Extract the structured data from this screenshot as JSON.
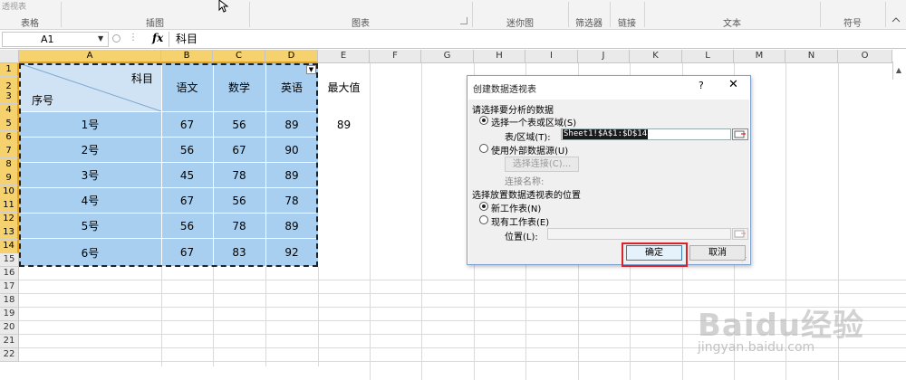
{
  "ribbon": {
    "top_text": "透视表",
    "groups": [
      {
        "name": "table",
        "label": "表格"
      },
      {
        "name": "illustrations",
        "label": "插图"
      },
      {
        "name": "charts",
        "label": "图表"
      },
      {
        "name": "sparklines",
        "label": "迷你图"
      },
      {
        "name": "filters",
        "label": "筛选器"
      },
      {
        "name": "links",
        "label": "链接"
      },
      {
        "name": "text",
        "label": "文本"
      },
      {
        "name": "symbols",
        "label": "符号"
      }
    ]
  },
  "formula_bar": {
    "name_box": "A1",
    "fx_label": "fx",
    "content": "科目"
  },
  "sheet": {
    "columns": [
      "A",
      "B",
      "C",
      "D",
      "E",
      "F",
      "G",
      "H",
      "I",
      "J",
      "K",
      "L",
      "M",
      "N",
      "O"
    ],
    "rows": [
      "1",
      "2",
      "3",
      "4",
      "5",
      "6",
      "7",
      "8",
      "9",
      "10",
      "11",
      "12",
      "13",
      "14",
      "15",
      "16",
      "17",
      "18",
      "19",
      "20",
      "21",
      "22"
    ],
    "header": {
      "diag_top": "科目",
      "diag_bottom": "序号",
      "subjects": [
        "语文",
        "数学",
        "英语"
      ],
      "max_label": "最大值"
    },
    "students": [
      {
        "id": "1号",
        "scores": [
          67,
          56,
          89
        ]
      },
      {
        "id": "2号",
        "scores": [
          56,
          67,
          90
        ]
      },
      {
        "id": "3号",
        "scores": [
          45,
          78,
          89
        ]
      },
      {
        "id": "4号",
        "scores": [
          67,
          56,
          78
        ]
      },
      {
        "id": "5号",
        "scores": [
          56,
          78,
          89
        ]
      },
      {
        "id": "6号",
        "scores": [
          67,
          83,
          92
        ]
      }
    ],
    "max_value": 89
  },
  "dialog": {
    "title": "创建数据透视表",
    "help": "?",
    "close": "✕",
    "section1": "请选择要分析的数据",
    "option_table": "选择一个表或区域(S)",
    "range_label": "表/区域(T):",
    "range_value": "Sheet1!$A$1:$D$14",
    "option_external": "使用外部数据源(U)",
    "choose_conn": "选择连接(C)...",
    "conn_name_label": "连接名称:",
    "section2": "选择放置数据透视表的位置",
    "option_new": "新工作表(N)",
    "option_existing": "现有工作表(E)",
    "location_label": "位置(L):",
    "ok": "确定",
    "cancel": "取消"
  },
  "watermark": {
    "logo": "Baidu经验",
    "url": "jingyan.baidu.com"
  },
  "colors": {
    "selection_fill": "#cfe3f5",
    "table_fill": "#a9cff0",
    "header_selected": "#f5d26e",
    "highlight_red": "#d9232a"
  }
}
